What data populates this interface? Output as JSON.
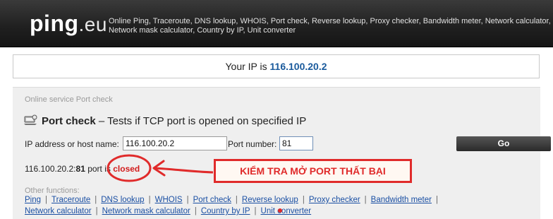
{
  "header": {
    "logo_main": "ping",
    "logo_tld": ".eu",
    "tagline": "Online Ping, Traceroute, DNS lookup, WHOIS, Port check, Reverse lookup, Proxy checker, Bandwidth meter, Network calculator, Network mask calculator, Country by IP, Unit converter"
  },
  "ipbar": {
    "prefix": "Your IP is",
    "ip": "116.100.20.2"
  },
  "panel": {
    "breadcrumb": "Online service Port check",
    "title": "Port check",
    "subtitle": "– Tests if TCP port is opened on specified IP",
    "icon": "port-check-icon"
  },
  "form": {
    "host_label": "IP address or host name:",
    "host_value": "116.100.20.2",
    "port_label": "Port number:",
    "port_value": "81",
    "go_label": "Go"
  },
  "result": {
    "host": "116.100.20.2:",
    "port": "81",
    "text": " port is ",
    "status": "closed"
  },
  "other": {
    "label": "Other functions:",
    "row1": [
      "Ping",
      "Traceroute",
      "DNS lookup",
      "WHOIS",
      "Port check",
      "Reverse lookup",
      "Proxy checker",
      "Bandwidth meter"
    ],
    "row2": [
      "Network calculator",
      "Network mask calculator",
      "Country by IP",
      "Unit converter"
    ]
  },
  "annotation": {
    "text": "KIỂM TRA MỞ PORT THẤT BẠI",
    "color": "#e02b2b"
  }
}
